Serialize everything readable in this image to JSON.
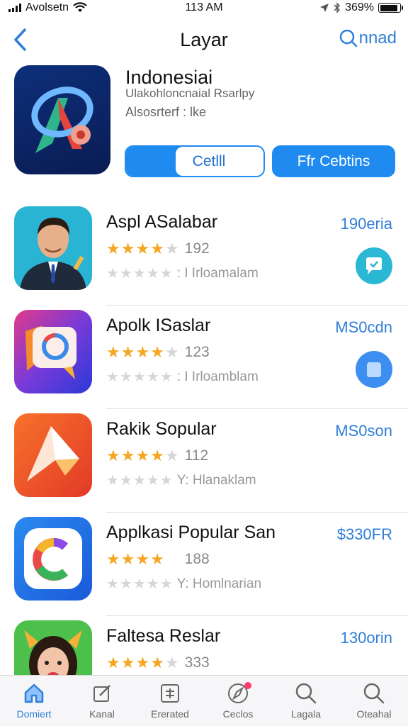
{
  "status_bar": {
    "carrier": "Avolsetn",
    "time": "113 AM",
    "battery_percent": "369%",
    "battery_level": 0.9
  },
  "nav": {
    "title": "Layar",
    "right_label": "nnad",
    "accent_color": "#2f7fd8"
  },
  "featured": {
    "title": "Indonesiai",
    "subtitle": "Ulakohloncnaial Rsarlpy",
    "meta": "Alsosrterf : lke",
    "primary_button": "Cetlll",
    "secondary_button": "Ffr Cebtins"
  },
  "apps": [
    {
      "name": "Aspl ASalabar",
      "price": "190eria",
      "rating_count": "192",
      "stars": 4,
      "sub": ": I Irloamalam",
      "icon": "person-icon",
      "action_icon": "chat-icon",
      "action_color": "#2bb8d4"
    },
    {
      "name": "Apolk ISaslar",
      "price": "MS0cdn",
      "rating_count": "123",
      "stars": 4,
      "sub": ": I Irloamblam",
      "icon": "chat-bubble-icon",
      "action_icon": "page-icon",
      "action_color": "#3c8ff0"
    },
    {
      "name": "Rakik Sopular",
      "price": "MS0son",
      "rating_count": "112",
      "stars": 4,
      "sub": "Y: Hlanaklam",
      "icon": "star-icon",
      "action_icon": "",
      "action_color": ""
    },
    {
      "name": "Applkasi Popular San",
      "price": "$330FR",
      "rating_count": "188",
      "stars": 4,
      "sub": "Y: Homlnarian",
      "icon": "c-logo-icon",
      "action_icon": "",
      "action_color": ""
    },
    {
      "name": "Faltesa Reslar",
      "price": "130orin",
      "rating_count": "333",
      "stars": 4,
      "sub": "",
      "icon": "girl-icon",
      "action_icon": "",
      "action_color": ""
    }
  ],
  "tabbar": {
    "items": [
      {
        "label": "Domiert",
        "icon": "home-icon",
        "active": true
      },
      {
        "label": "Kanal",
        "icon": "edit-icon",
        "active": false
      },
      {
        "label": "Ererated",
        "icon": "box-icon",
        "active": false
      },
      {
        "label": "Ceclos",
        "icon": "compass-icon",
        "active": false
      },
      {
        "label": "Lagala",
        "icon": "search-icon",
        "active": false
      },
      {
        "label": "Oteahal",
        "icon": "search-icon",
        "active": false
      }
    ]
  }
}
